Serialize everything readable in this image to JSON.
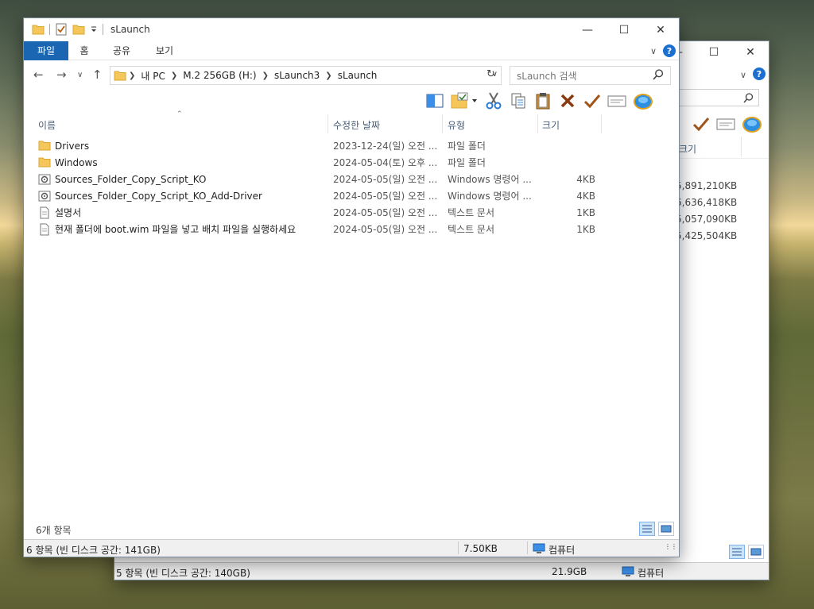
{
  "back_window": {
    "columns": {
      "size": "크기"
    },
    "sizes": [
      "5,891,210KB",
      "6,636,418KB",
      "5,057,090KB",
      "5,425,504KB"
    ],
    "status": {
      "items": "5 항목 (빈 디스크 공간: 140GB)",
      "size": "21.9GB",
      "location": "컴퓨터"
    }
  },
  "front_window": {
    "title": "sLaunch",
    "ribbon_tabs": [
      "파일",
      "홈",
      "공유",
      "보기"
    ],
    "breadcrumb": [
      "내 PC",
      "M.2 256GB (H:)",
      "sLaunch3",
      "sLaunch"
    ],
    "search_placeholder": "sLaunch 검색",
    "columns": {
      "name": "이름",
      "date": "수정한 날짜",
      "type": "유형",
      "size": "크기"
    },
    "files": [
      {
        "icon": "folder-icon",
        "name": "Drivers",
        "date": "2023-12-24(일) 오전 ...",
        "type": "파일 폴더",
        "size": ""
      },
      {
        "icon": "folder-icon",
        "name": "Windows",
        "date": "2024-05-04(토) 오후 ...",
        "type": "파일 폴더",
        "size": ""
      },
      {
        "icon": "script-icon",
        "name": "Sources_Folder_Copy_Script_KO",
        "date": "2024-05-05(일) 오전 ...",
        "type": "Windows 명령어 ...",
        "size": "4KB"
      },
      {
        "icon": "script-icon",
        "name": "Sources_Folder_Copy_Script_KO_Add-Driver",
        "date": "2024-05-05(일) 오전 ...",
        "type": "Windows 명령어 ...",
        "size": "4KB"
      },
      {
        "icon": "text-file-icon",
        "name": "설명서",
        "date": "2024-05-05(일) 오전 ...",
        "type": "텍스트 문서",
        "size": "1KB"
      },
      {
        "icon": "text-file-icon",
        "name": "현재 폴더에 boot.wim 파일을 넣고 배치 파일을 실행하세요",
        "date": "2024-05-05(일) 오전 ...",
        "type": "텍스트 문서",
        "size": "1KB"
      }
    ],
    "item_count": "6개 항목",
    "status": {
      "items": "6 항목 (빈 디스크 공간: 141GB)",
      "size": "7.50KB",
      "location": "컴퓨터"
    }
  },
  "colors": {
    "accent": "#1a66b3",
    "folder": "#f5c659",
    "header_text": "#4c607a"
  }
}
